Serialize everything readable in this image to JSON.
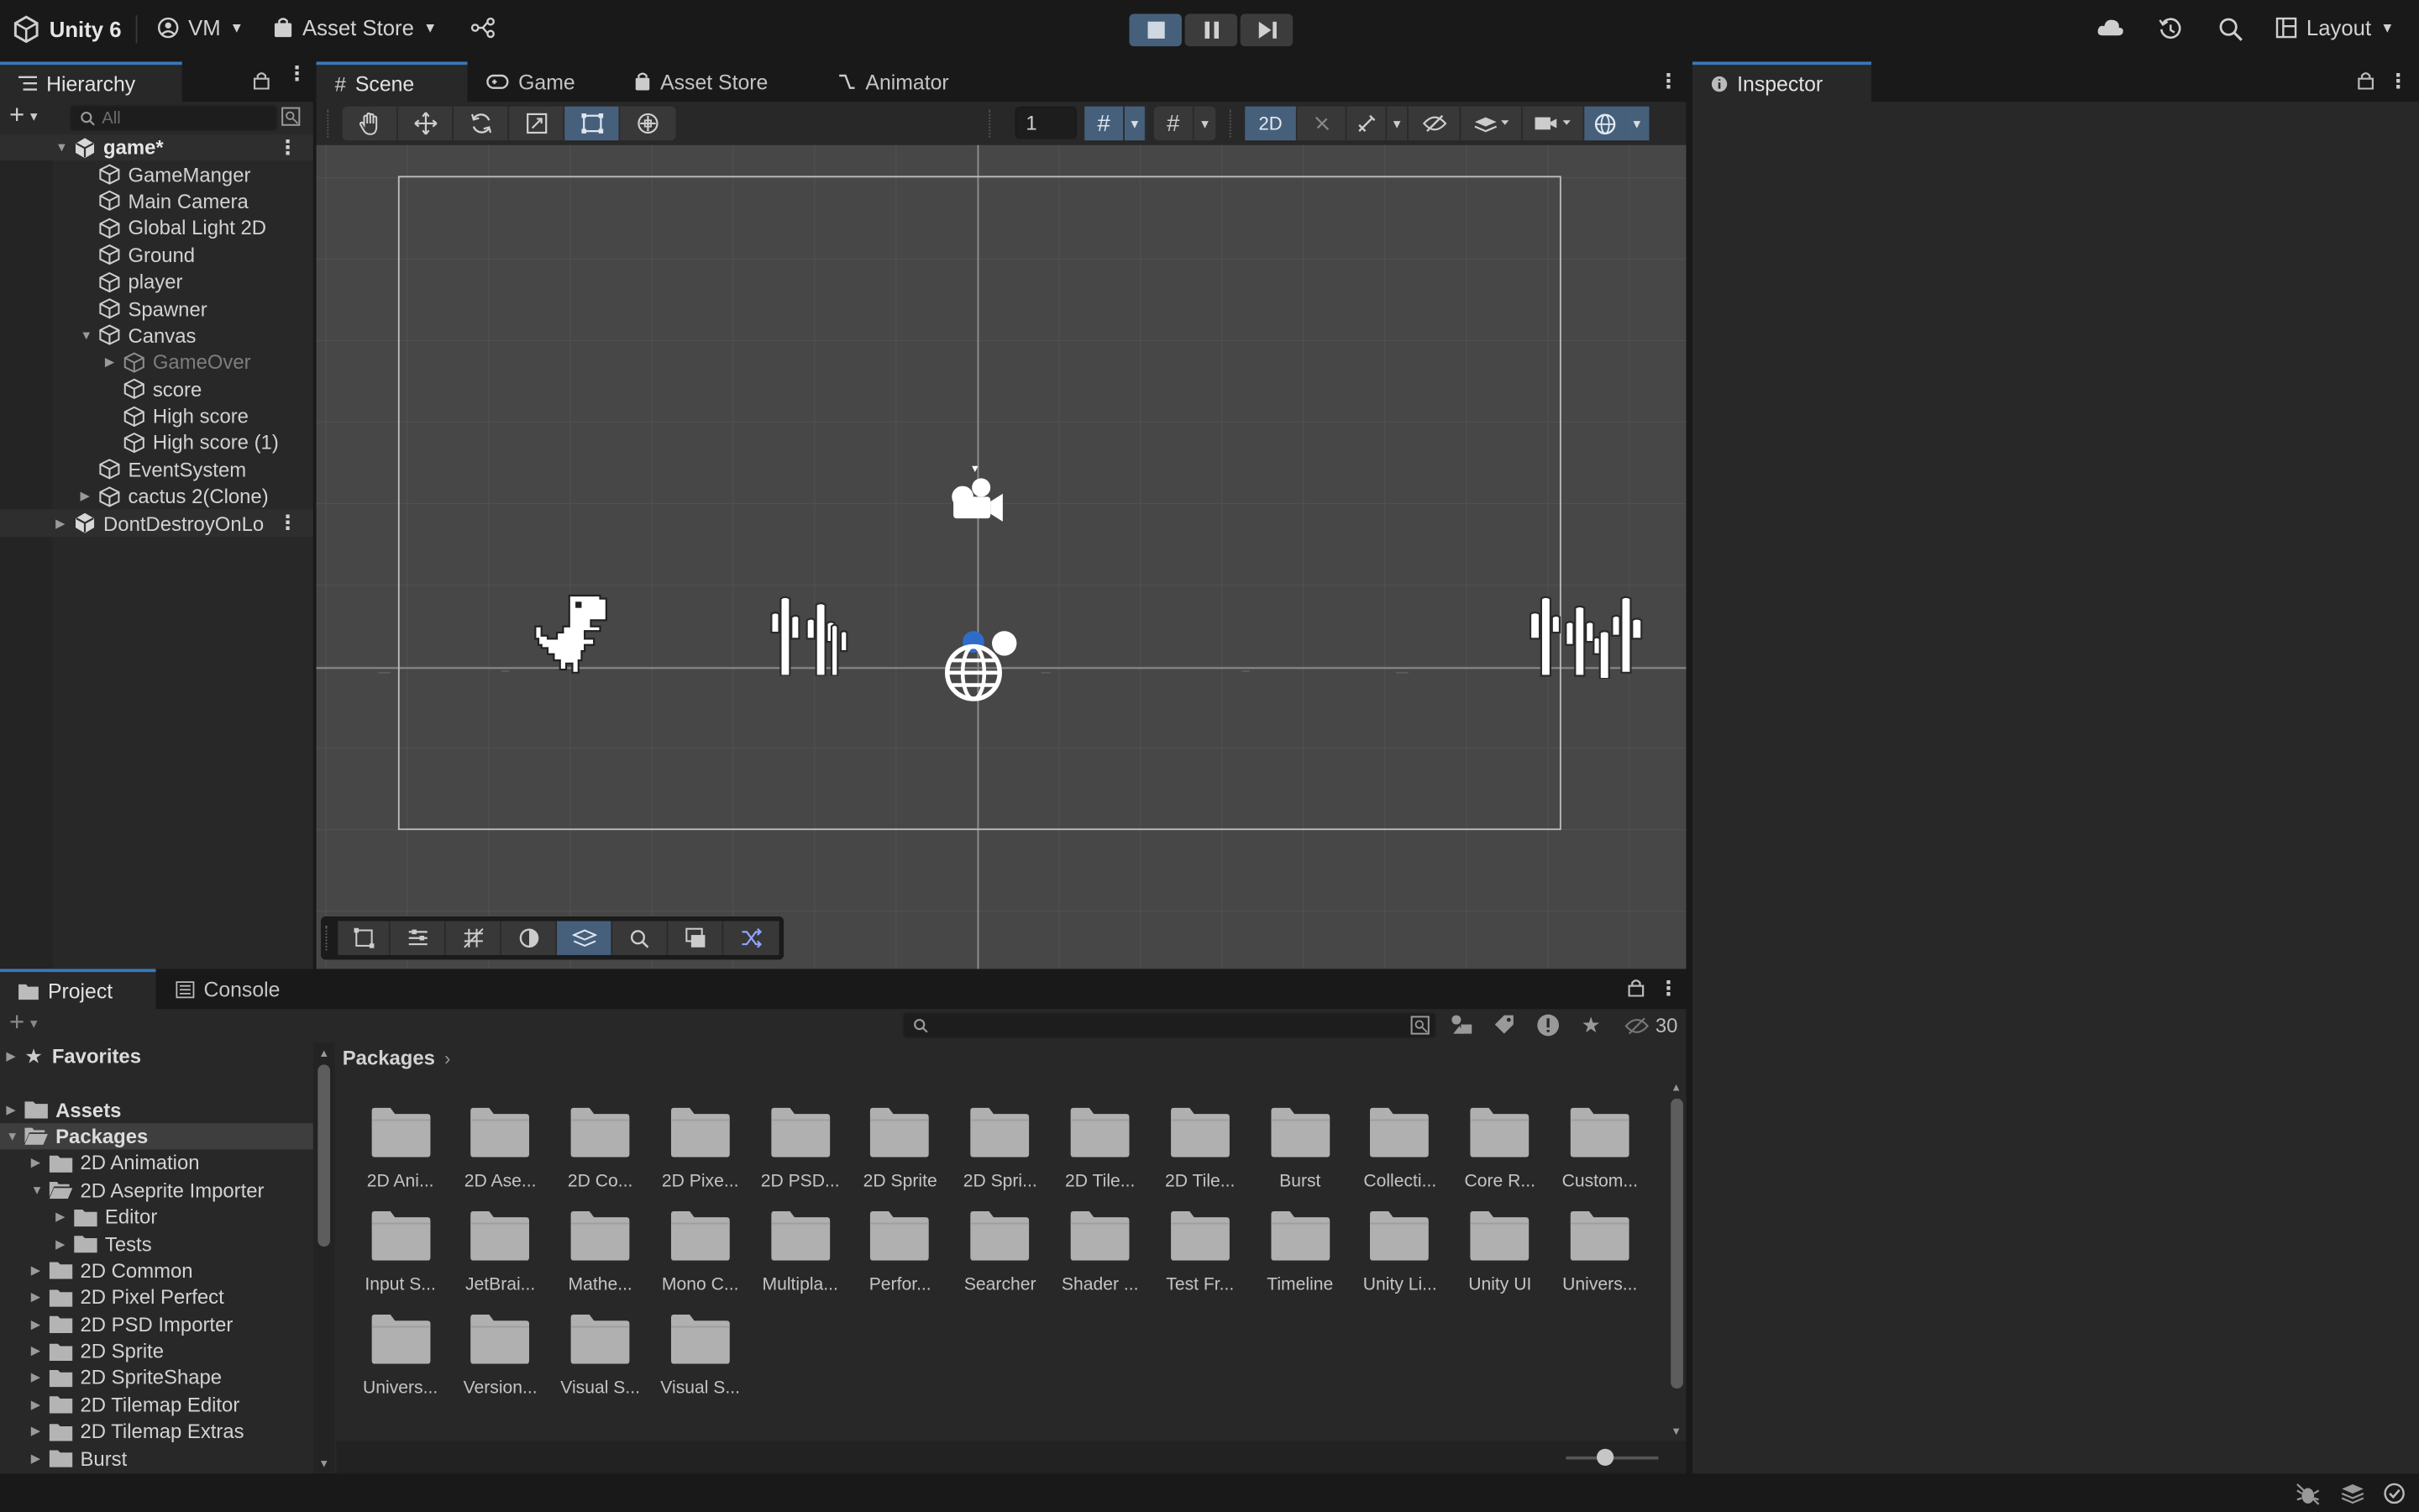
{
  "toolbar": {
    "app_name": "Unity 6",
    "account": "VM",
    "asset_store": "Asset Store",
    "layout": "Layout"
  },
  "hierarchy": {
    "tab": "Hierarchy",
    "search_placeholder": "All",
    "scene": "game*",
    "items": [
      {
        "label": "GameManger",
        "indent": 1
      },
      {
        "label": "Main Camera",
        "indent": 1
      },
      {
        "label": "Global Light 2D",
        "indent": 1
      },
      {
        "label": "Ground",
        "indent": 1
      },
      {
        "label": "player",
        "indent": 1
      },
      {
        "label": "Spawner",
        "indent": 1
      },
      {
        "label": "Canvas",
        "indent": 1
      },
      {
        "label": "GameOver",
        "indent": 2
      },
      {
        "label": "score",
        "indent": 2
      },
      {
        "label": "High score",
        "indent": 2
      },
      {
        "label": "High score (1)",
        "indent": 2
      },
      {
        "label": "EventSystem",
        "indent": 1
      },
      {
        "label": "cactus 2(Clone)",
        "indent": 1
      }
    ],
    "dont_destroy": "DontDestroyOnLo"
  },
  "center_tabs": {
    "scene": "Scene",
    "game": "Game",
    "asset_store": "Asset Store",
    "animator": "Animator"
  },
  "scene_toolbar": {
    "grid_size": "1",
    "mode_2d": "2D"
  },
  "inspector": {
    "tab": "Inspector"
  },
  "bottom_tabs": {
    "project": "Project",
    "console": "Console"
  },
  "project": {
    "hidden_count": "30",
    "breadcrumb": "Packages",
    "tree": [
      {
        "label": "Favorites",
        "indent": 0,
        "bold": true,
        "icon": "star-icon"
      },
      {
        "label": "Assets",
        "indent": 0,
        "bold": true,
        "icon": "folder-icon"
      },
      {
        "label": "Packages",
        "indent": 0,
        "bold": true,
        "icon": "folder-open-icon",
        "selected": true
      },
      {
        "label": "2D Animation",
        "indent": 1,
        "icon": "folder-icon"
      },
      {
        "label": "2D Aseprite Importer",
        "indent": 1,
        "icon": "folder-open-icon"
      },
      {
        "label": "Editor",
        "indent": 2,
        "icon": "folder-icon"
      },
      {
        "label": "Tests",
        "indent": 2,
        "icon": "folder-icon"
      },
      {
        "label": "2D Common",
        "indent": 1,
        "icon": "folder-icon"
      },
      {
        "label": "2D Pixel Perfect",
        "indent": 1,
        "icon": "folder-icon"
      },
      {
        "label": "2D PSD Importer",
        "indent": 1,
        "icon": "folder-icon"
      },
      {
        "label": "2D Sprite",
        "indent": 1,
        "icon": "folder-icon"
      },
      {
        "label": "2D SpriteShape",
        "indent": 1,
        "icon": "folder-icon"
      },
      {
        "label": "2D Tilemap Editor",
        "indent": 1,
        "icon": "folder-icon"
      },
      {
        "label": "2D Tilemap Extras",
        "indent": 1,
        "icon": "folder-icon"
      },
      {
        "label": "Burst",
        "indent": 1,
        "icon": "folder-icon"
      }
    ],
    "folders": [
      "2D Ani...",
      "2D Ase...",
      "2D Co...",
      "2D Pixe...",
      "2D PSD...",
      "2D Sprite",
      "2D Spri...",
      "2D Tile...",
      "2D Tile...",
      "Burst",
      "Collecti...",
      "Core R...",
      "Custom...",
      "Input S...",
      "JetBrai...",
      "Mathe...",
      "Mono C...",
      "Multipla...",
      "Perfor...",
      "Searcher",
      "Shader ...",
      "Test Fr...",
      "Timeline",
      "Unity Li...",
      "Unity UI",
      "Univers...",
      "Univers...",
      "Version...",
      "Visual S...",
      "Visual S..."
    ]
  },
  "colors": {
    "accent": "#3a79bb",
    "panel": "#282828",
    "scene_bg": "#474747"
  }
}
